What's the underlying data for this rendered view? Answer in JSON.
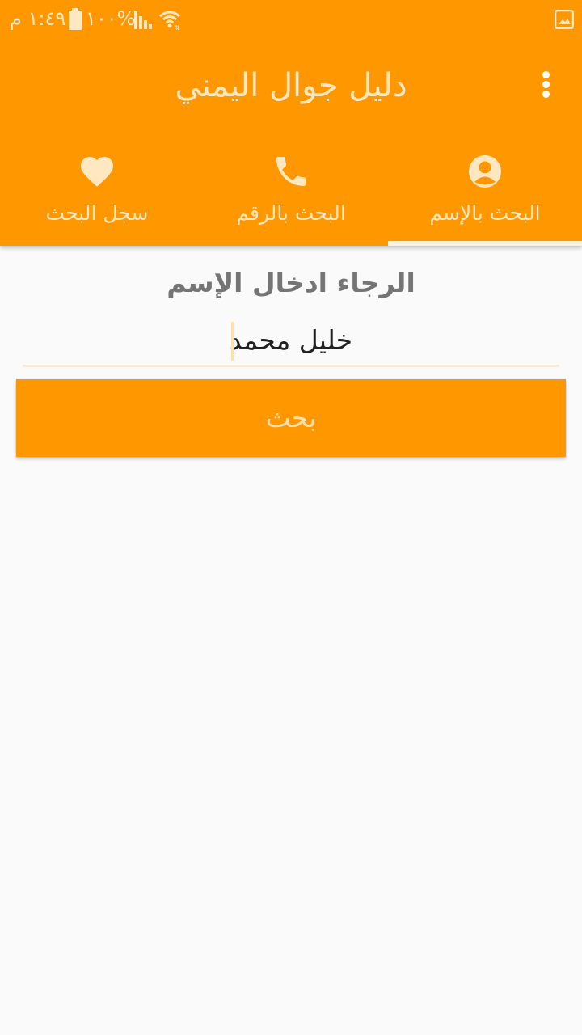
{
  "status_bar": {
    "time": "١:٤٩ م",
    "battery": "%١٠٠",
    "icons": [
      "battery-icon",
      "signal-icon",
      "wifi-icon",
      "gallery-notification-icon"
    ]
  },
  "toolbar": {
    "title": "دليل جوال اليمني",
    "more_icon": "more-vertical-icon"
  },
  "tabs": [
    {
      "label": "البحث بالإسم",
      "icon": "person-icon",
      "selected": true
    },
    {
      "label": "البحث بالرقم",
      "icon": "phone-icon",
      "selected": false
    },
    {
      "label": "سجل البحث",
      "icon": "heart-icon",
      "selected": false
    }
  ],
  "form": {
    "prompt": "الرجاء ادخال الإسم",
    "name_value": "خليل محمد",
    "search_label": "بحث"
  },
  "colors": {
    "primary": "#FF9800",
    "text_on_primary": "#FFE7C2",
    "background": "#FAFAFA",
    "label_gray": "#757575"
  }
}
